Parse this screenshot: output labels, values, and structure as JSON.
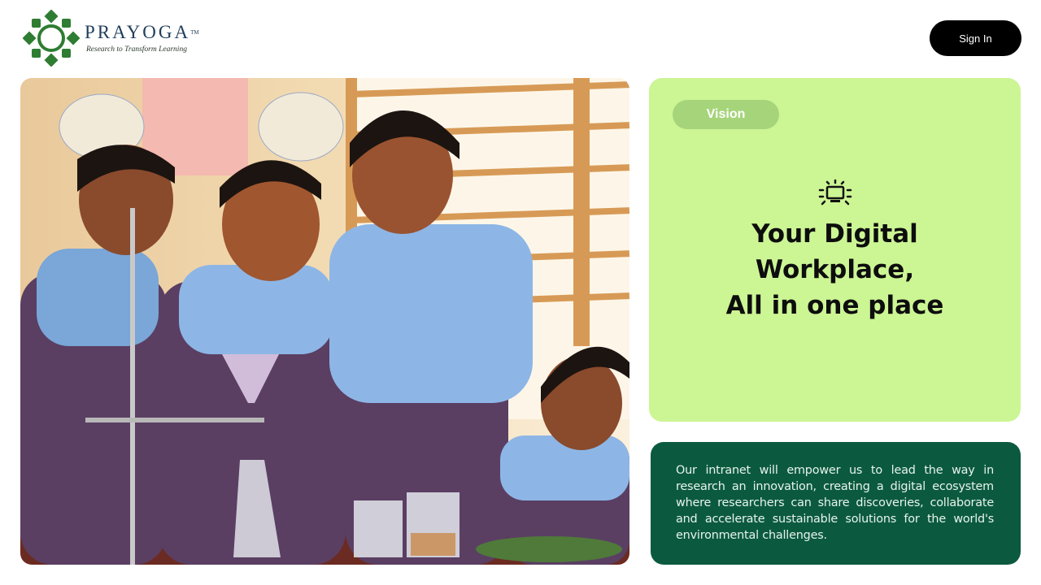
{
  "brand": {
    "name": "PRAYOGA",
    "trademark": "TM",
    "tagline": "Research to Transform Learning"
  },
  "header": {
    "signin_label": "Sign In"
  },
  "vision": {
    "pill_label": "Vision",
    "icon": "monitor-icon",
    "headline_lines": [
      "Your Digital",
      "Workplace,",
      "All in one place"
    ]
  },
  "description": {
    "text": "Our intranet will empower us to lead the way in research an innovation, creating a digital ecosystem where researchers can share discoveries, collaborate and accelerate sustainable solutions for the world's environmental challenges."
  },
  "colors": {
    "vision_bg": "#ccf594",
    "pill_bg": "#a6d47a",
    "desc_bg": "#0b5a40",
    "button_bg": "#000000",
    "logo_green": "#2e7d32"
  }
}
